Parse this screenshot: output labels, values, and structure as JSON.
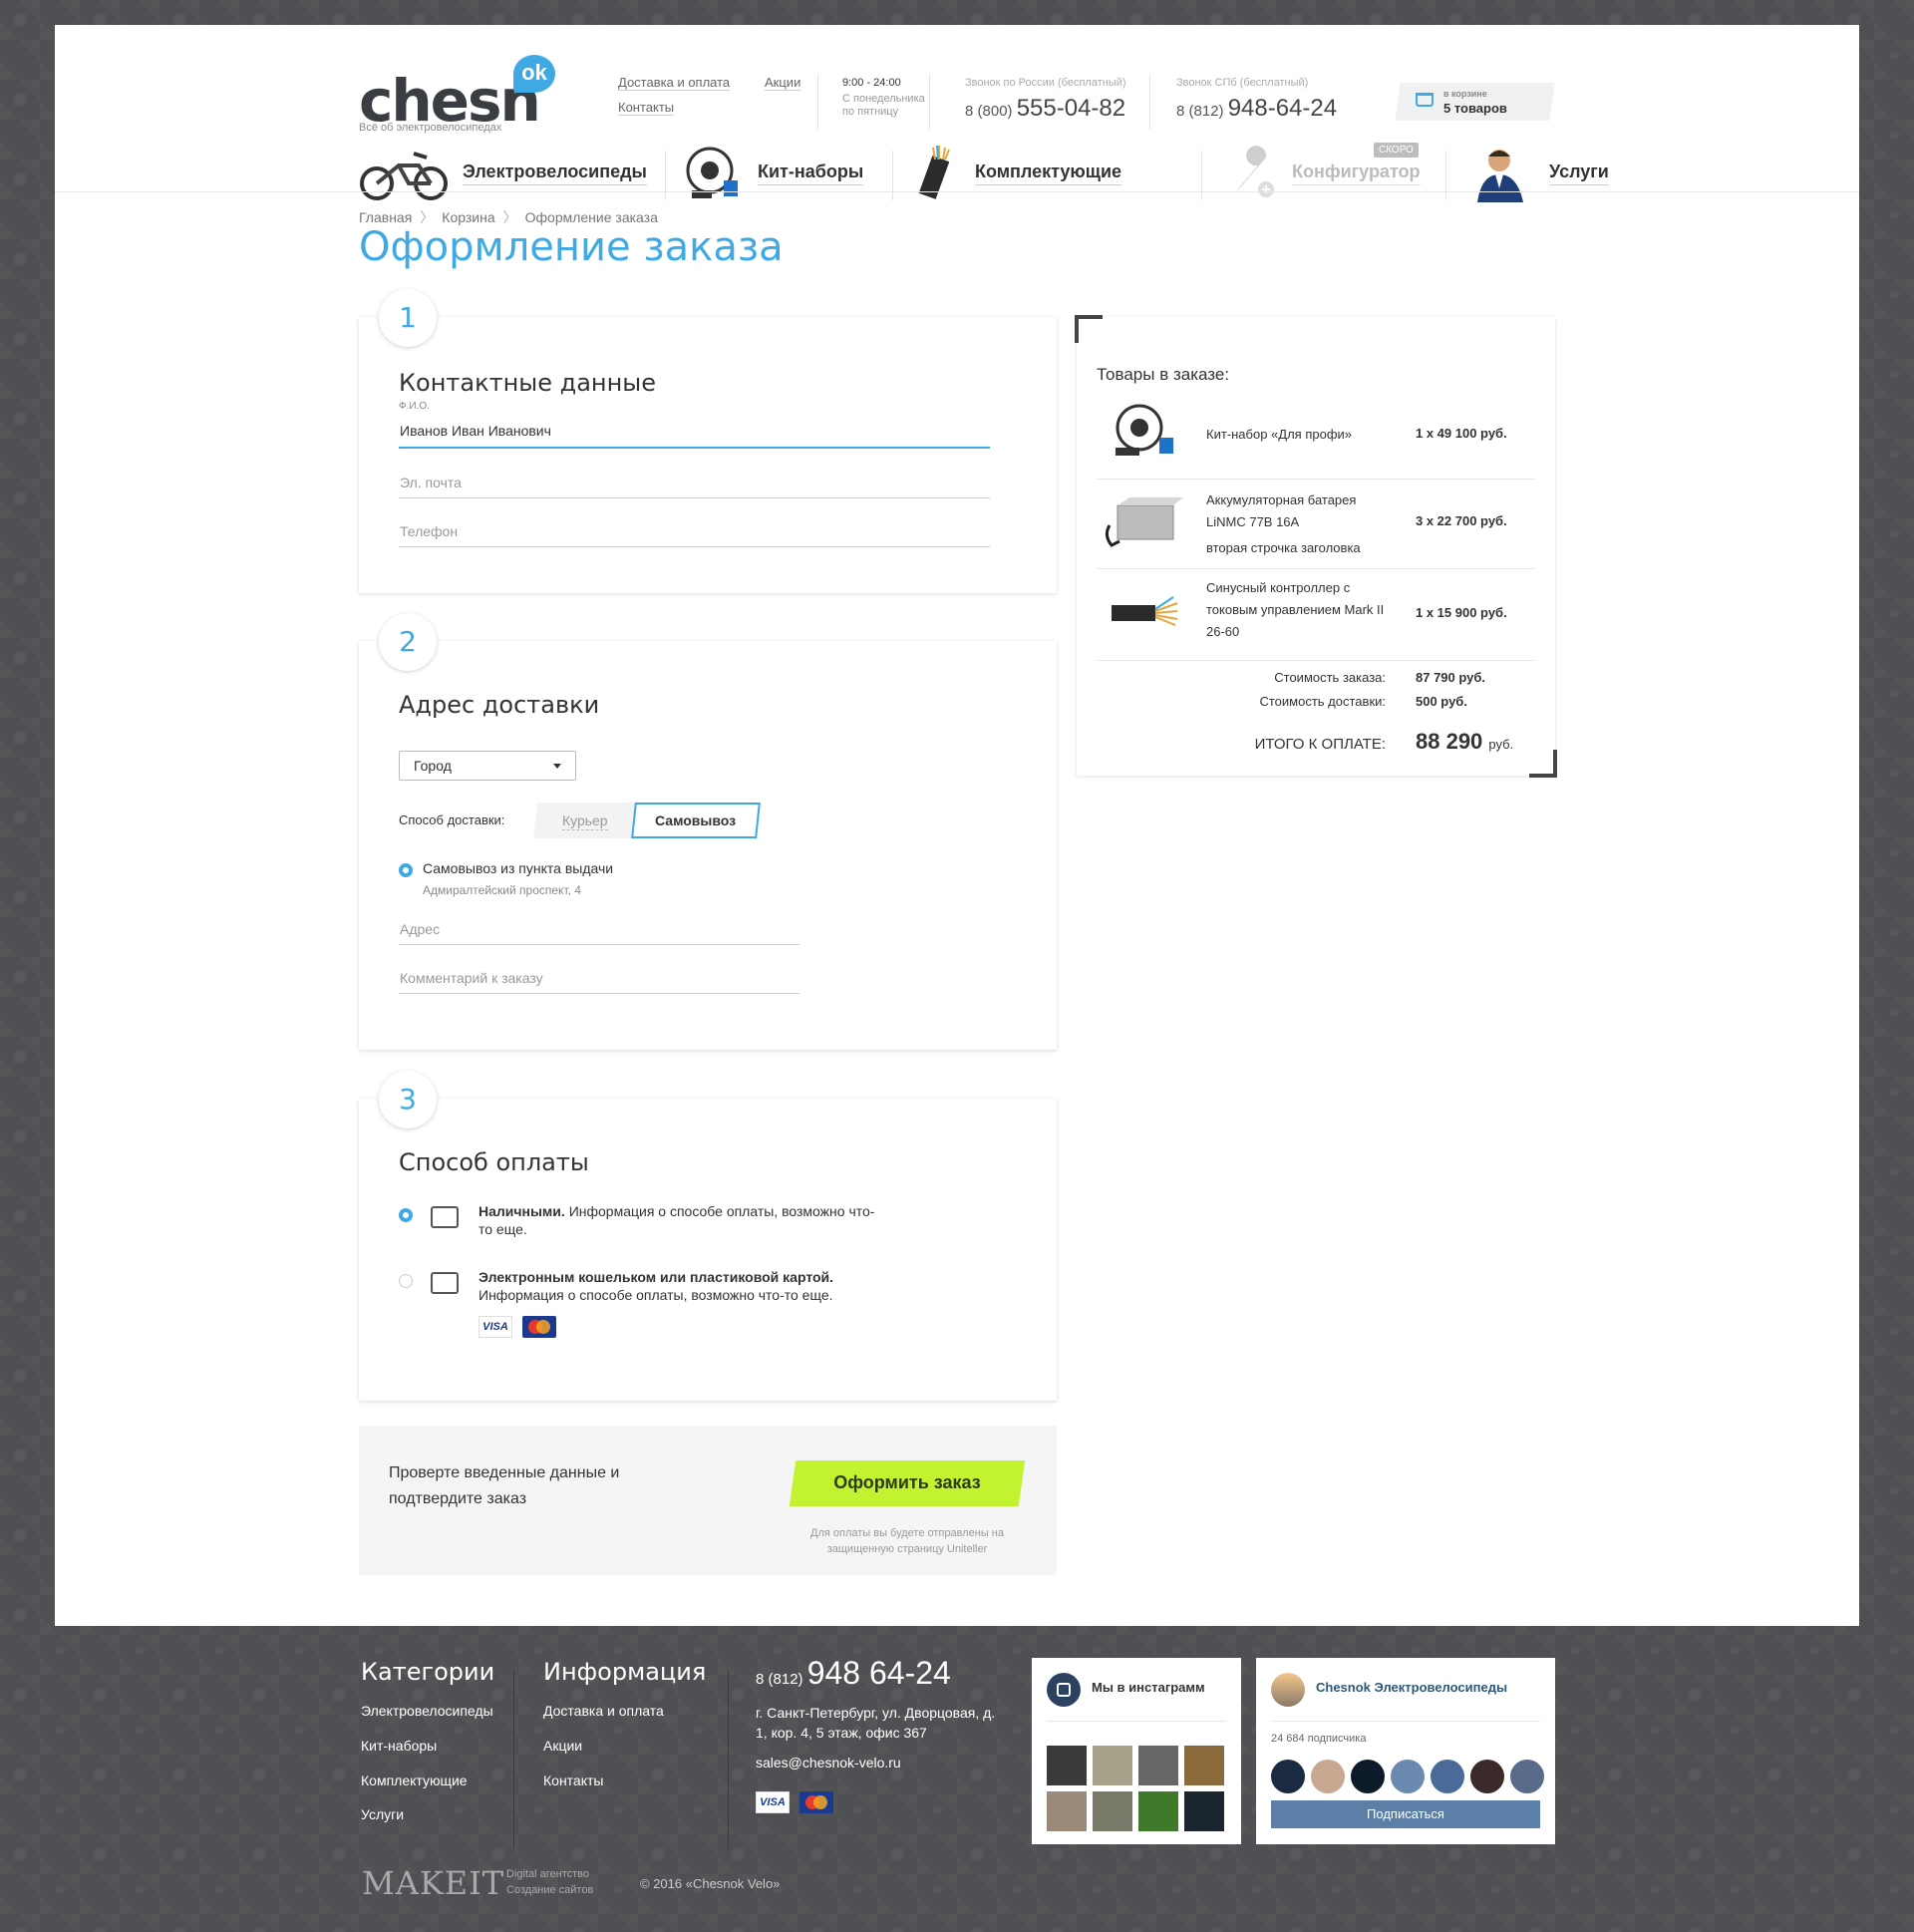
{
  "header": {
    "logo_text": "chesn",
    "logo_ok": "ok",
    "logo_tagline": "Всё об электровелосипедах",
    "links": [
      "Доставка и оплата",
      "Контакты"
    ],
    "promo_link": "Акции",
    "hours": "9:00 - 24:00",
    "hours_sub_1": "С понедельника",
    "hours_sub_2": "по пятницу",
    "phone_ru_label": "Звонок по России (бесплатный)",
    "phone_ru_prefix": "8 (800)",
    "phone_ru_number": "555-04-82",
    "phone_spb_label": "Звонок СПб (бесплатный)",
    "phone_spb_prefix": "8 (812)",
    "phone_spb_number": "948-64-24",
    "cart_label": "в корзине",
    "cart_count": "5 товаров"
  },
  "nav": {
    "items": [
      {
        "label": "Электровелосипеды",
        "icon": "ebike-icon"
      },
      {
        "label": "Кит-наборы",
        "icon": "kit-icon"
      },
      {
        "label": "Комплектующие",
        "icon": "parts-icon"
      },
      {
        "label": "Конфигуратор",
        "icon": "wrench-icon",
        "badge": "СКОРО",
        "disabled": true
      },
      {
        "label": "Услуги",
        "icon": "person-icon"
      }
    ]
  },
  "breadcrumb": [
    "Главная",
    "Корзина",
    "Оформление заказа"
  ],
  "page_title": "Оформление заказа",
  "step1": {
    "number": "1",
    "title": "Контактные данные",
    "name_label": "Ф.И.О.",
    "name_value": "Иванов Иван Иванович",
    "email_placeholder": "Эл. почта",
    "phone_placeholder": "Телефон"
  },
  "step2": {
    "number": "2",
    "title": "Адрес доставки",
    "city_select": "Город",
    "delivery_label": "Способ доставки:",
    "tab_courier": "Курьер",
    "tab_pickup": "Самовывоз",
    "pickup_option": "Самовывоз из пункта выдачи",
    "pickup_address": "Адмиралтейский проспект, 4",
    "address_placeholder": "Адрес",
    "comment_placeholder": "Комментарий к заказу"
  },
  "step3": {
    "number": "3",
    "title": "Способ оплаты",
    "cash_bold": "Наличными.",
    "cash_text": "Информация о способе оплаты, возможно что-то еще.",
    "card_bold": "Электронным кошельком или пластиковой картой.",
    "card_text": "Информация о способе оплаты, возможно что-то еще.",
    "visa": "VISA"
  },
  "confirm": {
    "text": "Проверте введенные данные и подтвердите заказ",
    "button": "Оформить заказ",
    "note": "Для оплаты вы будете отправлены на защищенную страницу Uniteller"
  },
  "summary": {
    "title": "Товары в заказе:",
    "items": [
      {
        "name": "Кит-набор «Для профи»",
        "price": "1 x 49 100 руб."
      },
      {
        "name": "Аккумуляторная батарея LiNMC 77В 16А",
        "name2": "вторая строчка заголовка",
        "price": "3 x 22 700 руб."
      },
      {
        "name": "Синусный контроллер с токовым управлением Mark II 26-60",
        "price": "1 x 15 900 руб."
      }
    ],
    "order_cost_label": "Стоимость заказа:",
    "order_cost": "87 790 руб.",
    "delivery_cost_label": "Стоимость доставки:",
    "delivery_cost": "500 руб.",
    "total_label": "ИТОГО К ОПЛАТЕ:",
    "total": "88 290",
    "total_unit": "руб."
  },
  "footer": {
    "categories_title": "Категории",
    "categories": [
      "Электровелосипеды",
      "Кит-наборы",
      "Комплектующие",
      "Услуги"
    ],
    "info_title": "Информация",
    "info": [
      "Доставка и оплата",
      "Акции",
      "Контакты"
    ],
    "phone_prefix": "8 (812)",
    "phone_number": "948 64-24",
    "address": "г. Санкт-Петербург, ул. Дворцовая, д. 1, кор. 4, 5 этаж, офис 367",
    "email": "sales@chesnok-velo.ru",
    "visa": "VISA",
    "instagram_title": "Мы в инстаграмм",
    "vk_title": "Chesnok Электровелосипеды",
    "vk_subscribers": "24 684 подписчика",
    "vk_button": "Подписаться",
    "makeit": "MAKEIT",
    "makeit_sub_1": "Digital агентство",
    "makeit_sub_2": "Создание сайтов",
    "copyright": "© 2016 «Chesnok Velo»"
  },
  "colors": {
    "accent": "#3fa9e4",
    "button": "#c3f230",
    "background": "#4f5053",
    "vk_button": "#5b7fa6"
  }
}
